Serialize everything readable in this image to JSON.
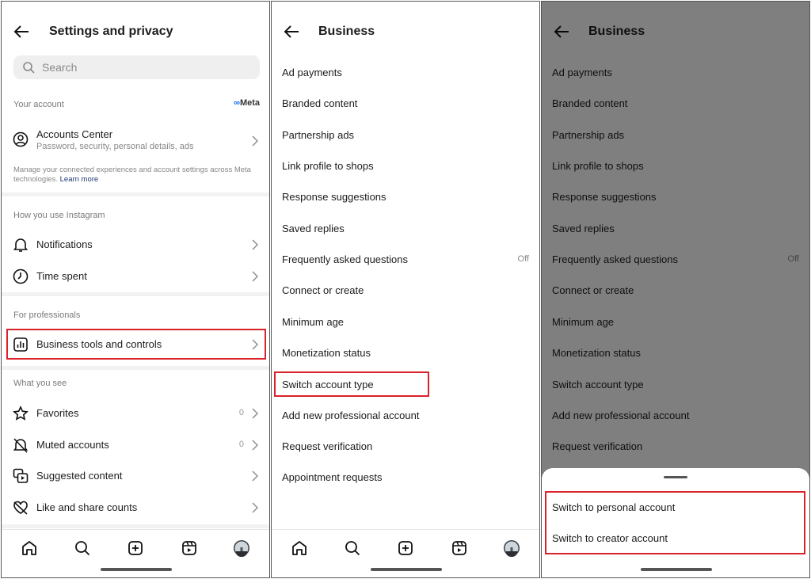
{
  "settings": {
    "title": "Settings and privacy",
    "search_placeholder": "Search",
    "your_account": "Your account",
    "meta_logo": "Meta",
    "accounts_center": {
      "title": "Accounts Center",
      "subtitle": "Password, security, personal details, ads"
    },
    "info_text": "Manage your connected experiences and account settings across Meta technologies.",
    "learn_more": "Learn more",
    "how_you_use": "How you use Instagram",
    "notifications": "Notifications",
    "time_spent": "Time spent",
    "for_professionals": "For professionals",
    "business_tools": "Business tools and controls",
    "what_you_see": "What you see",
    "favorites": {
      "label": "Favorites",
      "count": "0"
    },
    "muted": {
      "label": "Muted accounts",
      "count": "0"
    },
    "suggested": "Suggested content",
    "like_share": "Like and share counts"
  },
  "business": {
    "title": "Business",
    "items": [
      {
        "label": "Ad payments"
      },
      {
        "label": "Branded content"
      },
      {
        "label": "Partnership ads"
      },
      {
        "label": "Link profile to shops"
      },
      {
        "label": "Response suggestions"
      },
      {
        "label": "Saved replies"
      },
      {
        "label": "Frequently asked questions",
        "value": "Off"
      },
      {
        "label": "Connect or create"
      },
      {
        "label": "Minimum age"
      },
      {
        "label": "Monetization status"
      },
      {
        "label": "Switch account type"
      },
      {
        "label": "Add new professional account"
      },
      {
        "label": "Request verification"
      },
      {
        "label": "Appointment requests"
      }
    ]
  },
  "sheet": {
    "options": [
      "Switch to personal account",
      "Switch to creator account"
    ]
  },
  "nav": [
    "home",
    "search",
    "create",
    "reels",
    "profile"
  ],
  "colors": {
    "highlight": "#d9222a",
    "link": "#1e3a70",
    "overlay": "rgba(0,0,0,0.5)"
  }
}
